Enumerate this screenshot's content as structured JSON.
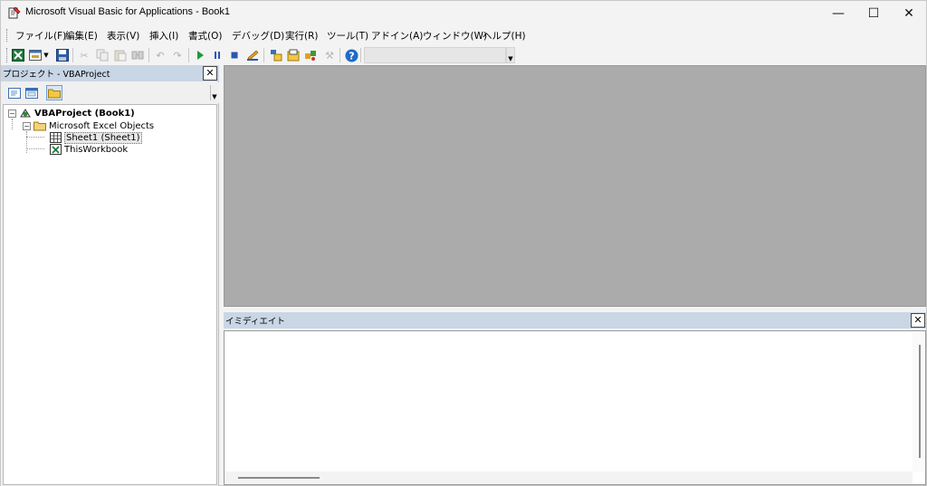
{
  "window": {
    "title": "Microsoft Visual Basic for Applications - Book1",
    "minimize_glyph": "—",
    "maximize_glyph": "☐",
    "close_glyph": "✕"
  },
  "menu": {
    "items": [
      {
        "label": "ファイル(F)"
      },
      {
        "label": "編集(E)"
      },
      {
        "label": "表示(V)"
      },
      {
        "label": "挿入(I)"
      },
      {
        "label": "書式(O)"
      },
      {
        "label": "デバッグ(D)"
      },
      {
        "label": "実行(R)"
      },
      {
        "label": "ツール(T)"
      },
      {
        "label": "アドイン(A)"
      },
      {
        "label": "ウィンドウ(W)"
      },
      {
        "label": "ヘルプ(H)"
      }
    ]
  },
  "toolbar": {
    "icons": [
      "excel-icon",
      "insert-userform-icon",
      "save-icon",
      "cut-icon",
      "copy-icon",
      "paste-icon",
      "find-icon",
      "undo-icon",
      "redo-icon",
      "run-icon",
      "break-icon",
      "reset-icon",
      "design-mode-icon",
      "project-explorer-icon",
      "properties-icon",
      "object-browser-icon",
      "toolbox-icon",
      "help-icon"
    ],
    "combo_value": ""
  },
  "project_pane": {
    "title": "プロジェクト - VBAProject",
    "close_glyph": "✕",
    "tree": {
      "root": "VBAProject (Book1)",
      "folder": "Microsoft Excel Objects",
      "sheet": "Sheet1 (Sheet1)",
      "workbook": "ThisWorkbook"
    }
  },
  "immediate": {
    "title": "イミディエイト",
    "close_glyph": "✕"
  },
  "colors": {
    "pane_title": "#c9d6e6",
    "code_area": "#ababab",
    "accent": "#1e6cc8"
  }
}
